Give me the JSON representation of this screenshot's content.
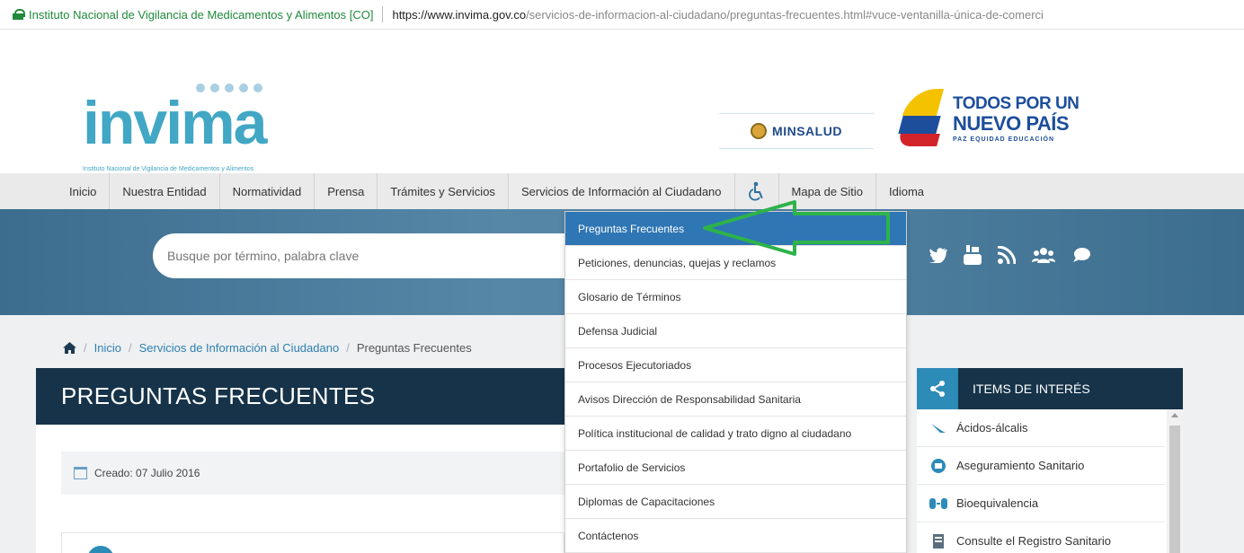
{
  "browser": {
    "site_identity": "Instituto Nacional de Vigilancia de Medicamentos y Alimentos [CO]",
    "url_host": "https://www.invima.gov.co",
    "url_path": "/servicios-de-informacion-al-ciudadano/preguntas-frecuentes.html#vuce-ventanilla-única-de-comerci"
  },
  "header": {
    "logo_word": "invima",
    "logo_tagline": "Instituto Nacional de Vigilancia de Medicamentos y Alimentos",
    "minsalud": "MINSALUD",
    "todos_line1": "TODOS POR UN",
    "todos_line2": "NUEVO PAÍS",
    "todos_line3": "PAZ  EQUIDAD  EDUCACIÓN"
  },
  "nav": {
    "items": [
      "Inicio",
      "Nuestra Entidad",
      "Normatividad",
      "Prensa",
      "Trámites y Servicios",
      "Servicios de Información al Ciudadano",
      "",
      "Mapa de Sitio",
      "Idioma"
    ]
  },
  "search": {
    "placeholder": "Busque por término, palabra clave"
  },
  "breadcrumb": {
    "inicio": "Inicio",
    "section": "Servicios de Información al Ciudadano",
    "current": "Preguntas Frecuentes",
    "sep": "/"
  },
  "page": {
    "title": "PREGUNTAS FRECUENTES",
    "created": "Creado: 07 Julio 2016"
  },
  "dropdown": {
    "items": [
      "Preguntas Frecuentes",
      "Peticiones, denuncias, quejas y reclamos",
      "Glosario de Términos",
      "Defensa Judicial",
      "Procesos Ejecutoriados",
      "Avisos Dirección de Responsabilidad Sanitaria",
      "Política institucional de calidad y trato digno al ciudadano",
      "Portafolio de Servicios",
      "Diplomas de Capacitaciones",
      "Contáctenos"
    ]
  },
  "sidebar": {
    "title": "ITEMS DE INTERÉS",
    "items": [
      "Ácidos-álcalis",
      "Aseguramiento Sanitario",
      "Bioequivalencia",
      "Consulte el Registro Sanitario"
    ]
  },
  "colors": {
    "dark_navy": "#163349",
    "accent_blue": "#2f76b4",
    "arrow_green": "#2db34a",
    "link_blue": "#2e7fb1"
  }
}
